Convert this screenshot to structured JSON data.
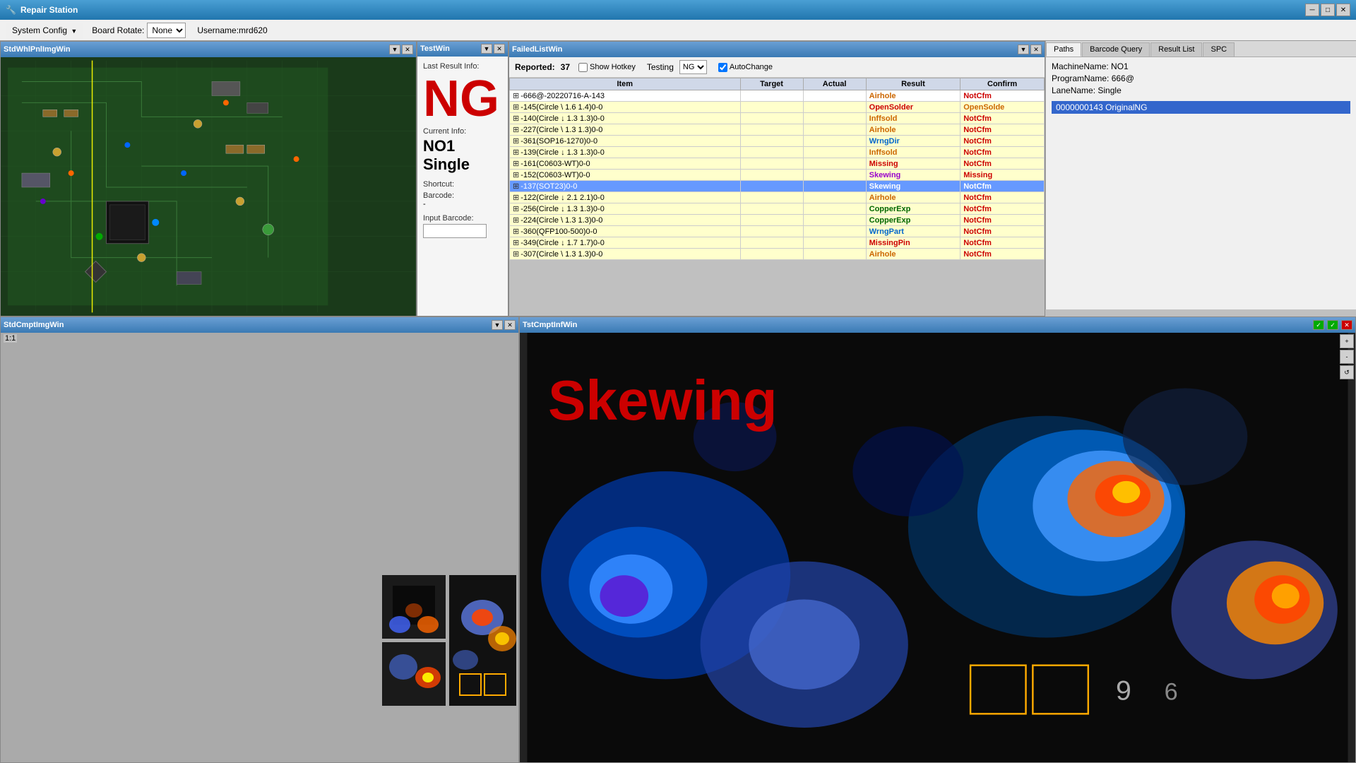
{
  "window": {
    "title": "Repair Station",
    "controls": [
      "minimize",
      "maximize",
      "close"
    ]
  },
  "menubar": {
    "system_config_label": "System Config",
    "board_rotate_label": "Board Rotate:",
    "board_rotate_value": "None",
    "username_label": "Username:mrd620"
  },
  "panels": {
    "top_left": {
      "title": "StdWhlPnlImgWin"
    },
    "test_win": {
      "title": "TestWin",
      "last_result_label": "Last Result Info:",
      "ng_text": "NG",
      "current_info_label": "Current Info:",
      "current_machine": "NO1",
      "current_lane": "Single",
      "shortcut_label": "Shortcut:",
      "barcode_label": "Barcode:",
      "barcode_value": "-",
      "input_barcode_label": "Input Barcode:"
    },
    "failed_list": {
      "title": "FailedListWin",
      "reported_label": "Reported:",
      "reported_count": "37",
      "show_hotkey_label": "Show Hotkey",
      "show_hotkey_checked": false,
      "testing_label": "Testing",
      "testing_value": "NG",
      "autochange_label": "AutoChange",
      "autochange_checked": true,
      "table": {
        "headers": [
          "Item",
          "Target",
          "Actual",
          "Result",
          "Confirm"
        ],
        "rows": [
          {
            "item": "-666@-20220716-A-143",
            "target": "",
            "actual": "",
            "result": "Airhole",
            "confirm": "NotCfm",
            "style": "white",
            "expand": true
          },
          {
            "item": "-145(Circle \\ 1.6 1.4)0-0",
            "target": "",
            "actual": "",
            "result": "OpenSolder",
            "confirm": "OpenSolde",
            "style": "yellow"
          },
          {
            "item": "-140(Circle ↓ 1.3 1.3)0-0",
            "target": "",
            "actual": "",
            "result": "Inffsold",
            "confirm": "NotCfm",
            "style": "yellow"
          },
          {
            "item": "-227(Circle \\ 1.3 1.3)0-0",
            "target": "",
            "actual": "",
            "result": "Airhole",
            "confirm": "NotCfm",
            "style": "yellow"
          },
          {
            "item": "-361(SOP16-1270)0-0",
            "target": "",
            "actual": "",
            "result": "WrngDir",
            "confirm": "NotCfm",
            "style": "yellow"
          },
          {
            "item": "-139(Circle ↓ 1.3 1.3)0-0",
            "target": "",
            "actual": "",
            "result": "Inffsold",
            "confirm": "NotCfm",
            "style": "yellow"
          },
          {
            "item": "-161(C0603-WT)0-0",
            "target": "",
            "actual": "",
            "result": "Missing",
            "confirm": "NotCfm",
            "style": "yellow"
          },
          {
            "item": "-152(C0603-WT)0-0",
            "target": "",
            "actual": "",
            "result": "Skewing",
            "confirm": "Missing",
            "style": "yellow"
          },
          {
            "item": "-137(SOT23)0-0",
            "target": "",
            "actual": "",
            "result": "Skewing",
            "confirm": "NotCfm",
            "style": "highlighted"
          },
          {
            "item": "-122(Circle ↓ 2.1 2.1)0-0",
            "target": "",
            "actual": "",
            "result": "Airhole",
            "confirm": "NotCfm",
            "style": "yellow"
          },
          {
            "item": "-256(Circle ↓ 1.3 1.3)0-0",
            "target": "",
            "actual": "",
            "result": "CopperExp",
            "confirm": "NotCfm",
            "style": "yellow"
          },
          {
            "item": "-224(Circle \\ 1.3 1.3)0-0",
            "target": "",
            "actual": "",
            "result": "CopperExp",
            "confirm": "NotCfm",
            "style": "yellow"
          },
          {
            "item": "-360(QFP100-500)0-0",
            "target": "",
            "actual": "",
            "result": "WrngPart",
            "confirm": "NotCfm",
            "style": "yellow"
          },
          {
            "item": "-349(Circle ↓ 1.7 1.7)0-0",
            "target": "",
            "actual": "",
            "result": "MissingPin",
            "confirm": "NotCfm",
            "style": "yellow"
          },
          {
            "item": "-307(Circle \\ 1.3 1.3)0-0",
            "target": "",
            "actual": "",
            "result": "Airhole",
            "confirm": "NotCfm",
            "style": "yellow"
          }
        ]
      }
    },
    "right": {
      "tabs": [
        "Paths",
        "Barcode Query",
        "Result List",
        "SPC"
      ],
      "active_tab": "Paths",
      "machine_name_label": "MachineName:",
      "machine_name_value": "NO1",
      "program_name_label": "ProgramName:",
      "program_name_value": "666@",
      "lane_name_label": "LaneName:",
      "lane_name_value": "Single",
      "result_item": "0000000143 OriginalNG"
    },
    "bottom_left": {
      "title": "StdCmptImgWin",
      "scale": "1:1"
    },
    "bottom_right": {
      "title": "TstCmptInfWin",
      "skewing_text": "Skewing"
    }
  }
}
